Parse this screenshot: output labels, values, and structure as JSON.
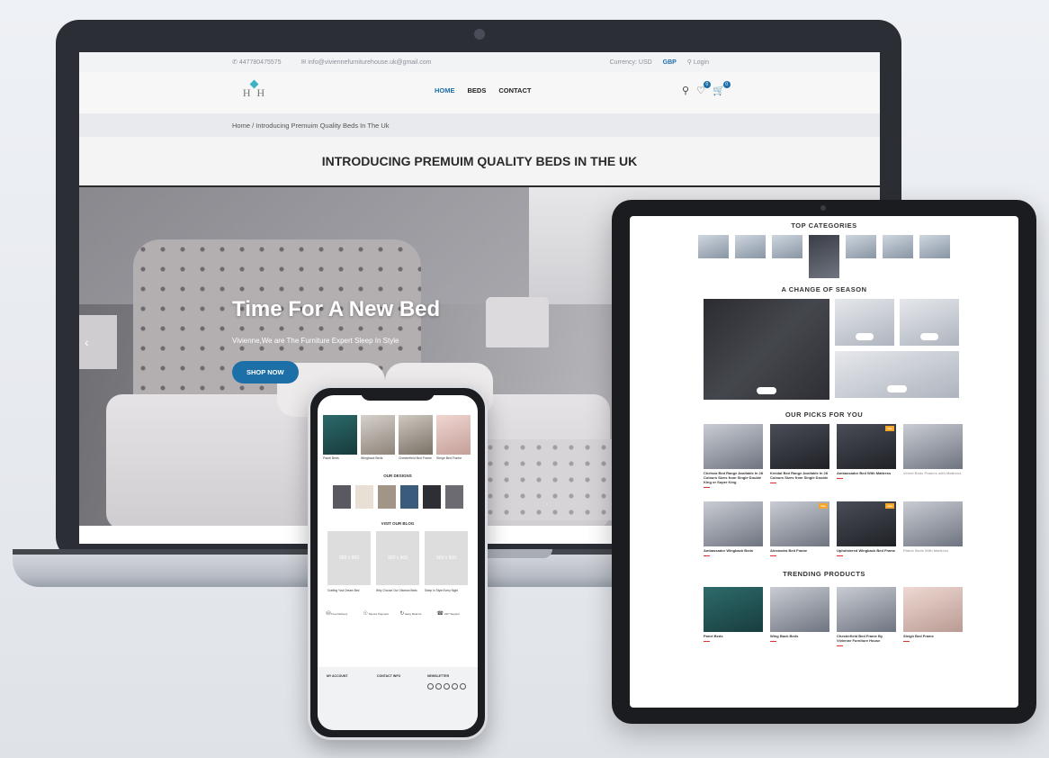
{
  "laptop": {
    "topbar": {
      "phone": "447780475575",
      "email": "info@viviennefurniturehouse.uk@gmail.com",
      "currency_label": "Currency: USD",
      "currency_selected": "GBP",
      "login": "Login"
    },
    "logo": {
      "monogram": "H H"
    },
    "nav": {
      "home": "HOME",
      "beds": "BEDS",
      "contact": "CONTACT",
      "wishlist_count": "0",
      "cart_count": "0"
    },
    "breadcrumb": {
      "home": "Home",
      "separator": "/",
      "current": "Introducing Premuim Quality Beds In The Uk"
    },
    "page_title": "INTRODUCING PREMUIM QUALITY BEDS IN THE UK",
    "hero": {
      "title": "Time For A New Bed",
      "subtitle": "Vivienne,We are The Furniture Expert Sleep In Style",
      "button": "SHOP NOW"
    }
  },
  "tablet": {
    "top_categories": {
      "title": "TOP CATEGORIES"
    },
    "season": {
      "title": "A CHANGE OF SEASON"
    },
    "picks": {
      "title": "OUR PICKS FOR YOU",
      "products": [
        {
          "name": "Chelsea Bed Range Available In 28 Colours Sizes from Single Double King or Super King",
          "tone": "light"
        },
        {
          "name": "Kendal Bed Range Available In 28 Colours Sizes from Single Double",
          "tone": "dark"
        },
        {
          "name": "Ambassador Bed With Mattress",
          "tone": "dark",
          "tag": "Sale"
        },
        {
          "name": "Velvet Beds Frames with Mattress",
          "tone": "light"
        },
        {
          "name": "Ambassador Wingback Beds",
          "tone": "light"
        },
        {
          "name": "Alexandra Bed Frame",
          "tone": "light",
          "tag": "Sale"
        },
        {
          "name": "Upholstered Wingback Bed Frame",
          "tone": "dark",
          "tag": "Sale"
        },
        {
          "name": "Fabric Beds With Mattress",
          "tone": "light"
        }
      ]
    },
    "trending": {
      "title": "TRENDING PRODUCTS",
      "products": [
        {
          "name": "Panel Beds",
          "tone": "teal"
        },
        {
          "name": "Wing Back Beds",
          "tone": "light"
        },
        {
          "name": "Chesterfield Bed Frame By Vivienne Furniture House",
          "tone": "light"
        },
        {
          "name": "Sleigh Bed Frame",
          "tone": "pink"
        }
      ]
    }
  },
  "phone": {
    "products": [
      {
        "name": "Panel Beds",
        "tone": ""
      },
      {
        "name": "Wingback Beds",
        "tone": "g"
      },
      {
        "name": "Chesterfield Bed Frame",
        "tone": "s"
      },
      {
        "name": "Sleigh Bed Frame",
        "tone": "p"
      }
    ],
    "our_designs_title": "OUR DESIGNS",
    "swatch_colors": [
      "#5a5860",
      "#e8e0d4",
      "#a29486",
      "#3b5b7c",
      "#2e2f35",
      "#6d6b72"
    ],
    "blog": {
      "title": "VISIT OUR BLOG",
      "placeholder": "900 x 900",
      "posts": [
        {
          "title": "Crafting Your Dream Bed"
        },
        {
          "title": "Why Choose Our Ottoman Beds"
        },
        {
          "title": "Sleep In Style Every Night"
        }
      ]
    },
    "features": [
      {
        "icon": "truck-icon",
        "label": "Free Delivery"
      },
      {
        "icon": "shield-icon",
        "label": "Secure Payment"
      },
      {
        "icon": "return-icon",
        "label": "Easy Returns"
      },
      {
        "icon": "support-icon",
        "label": "24/7 Support"
      }
    ],
    "footer": {
      "col1_title": "MY ACCOUNT",
      "col2_title": "CONTACT INFO",
      "col3_title": "NEWSLETTER"
    }
  },
  "colors": {
    "accent": "#1d6fa8",
    "sale": "#f4a62a",
    "price": "#dd3333"
  }
}
